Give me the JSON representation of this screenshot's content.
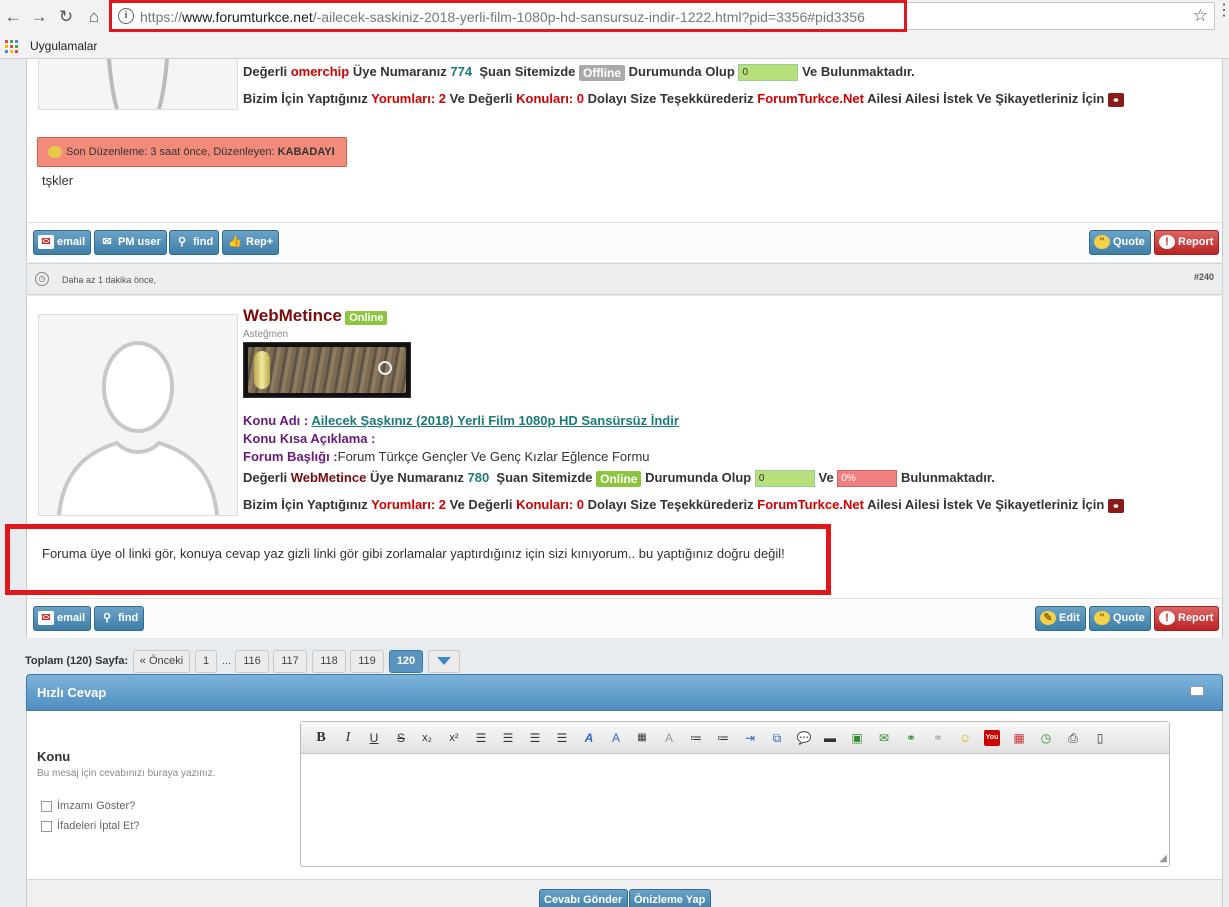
{
  "browser": {
    "url_prefix": "https://",
    "url_domain": "www.forumturkce.net",
    "url_path": "/-ailecek-saskiniz-2018-yerli-film-1080p-hd-sansursuz-indir-1222.html?pid=3356#pid3356",
    "bookmark_apps": "Uygulamalar"
  },
  "post1": {
    "line1": {
      "prefix": "Değerli",
      "user": "omerchip",
      "mid": "Üye Numaranız",
      "num": "774",
      "status_label": "Şuan Sitemizde",
      "status": "Offline",
      "after": "Durumunda Olup",
      "bar_value": "0",
      "suffix": "Ve Bulunmaktadır."
    },
    "line2": {
      "a": "Bizim İçin Yaptığınız",
      "comments": "Yorumları: 2",
      "b": "Ve Değerli",
      "topics": "Konuları: 0",
      "c": "Dolayı Size Teşekkürederiz",
      "site": "ForumTurkce.Net",
      "d": "Ailesi Ailesi İstek Ve Şikayetleriniz İçin"
    },
    "edit_note": "Son Düzenleme: 3 saat önce, Düzenleyen:",
    "edit_by": "KABADAYI",
    "message": "tşkler",
    "buttons": {
      "email": "email",
      "pm": "PM user",
      "find": "find",
      "rep": "Rep+",
      "quote": "Quote",
      "report": "Report"
    }
  },
  "post2_meta": {
    "time": "Daha az 1 dakika önce,",
    "num": "#240"
  },
  "post2": {
    "username": "WebMetince",
    "online": "Online",
    "rank": "Asteğmen",
    "konu_adi_label": "Konu Adı :",
    "konu_adi": "Ailecek Şaşkınız (2018) Yerli Film 1080p HD Sansürsüz İndir",
    "konu_kisa": "Konu Kısa Açıklama :",
    "forum_label": "Forum Başlığı :",
    "forum": "Forum Türkçe Gençler Ve Genç Kızlar Eğlence Formu",
    "line1": {
      "prefix": "Değerli",
      "user": "WebMetince",
      "mid": "Üye Numaranız",
      "num": "780",
      "status_label": "Şuan Sitemizde",
      "status": "Online",
      "after": "Durumunda Olup",
      "bar_value": "0",
      "ve": "Ve",
      "bar2_value": "0%",
      "suffix": "Bulunmaktadır."
    },
    "line2": {
      "a": "Bizim İçin Yaptığınız",
      "comments": "Yorumları: 2",
      "b": "Ve Değerli",
      "topics": "Konuları: 0",
      "c": "Dolayı Size Teşekkürederiz",
      "site": "ForumTurkce.Net",
      "d": "Ailesi Ailesi İstek Ve Şikayetleriniz İçin"
    },
    "message": "Foruma üye ol linki gör, konuya cevap yaz gizli linki gör gibi zorlamalar yaptırdığınız için sizi kınıyorum.. bu yaptığınız doğru değil!",
    "buttons": {
      "email": "email",
      "find": "find",
      "edit": "Edit",
      "quote": "Quote",
      "report": "Report"
    }
  },
  "pagination": {
    "label": "Toplam (120) Sayfa:",
    "prev": "« Önceki",
    "pages": [
      "1",
      "...",
      "116",
      "117",
      "118",
      "119",
      "120"
    ]
  },
  "quick_reply": {
    "title": "Hızlı Cevap",
    "konu_label": "Konu",
    "konu_desc": "Bu mesaj için cevabınızı buraya yazınız.",
    "signature": "İmzamı Göster?",
    "disable_smilies": "İfadeleri İptal Et?",
    "submit": "Cevabı Gönder",
    "preview": "Önizleme Yap"
  },
  "colors": {
    "accent": "#4f8ec0",
    "highlight": "#e0161b",
    "online": "#8cc63f",
    "offline": "#aaaaaa"
  }
}
